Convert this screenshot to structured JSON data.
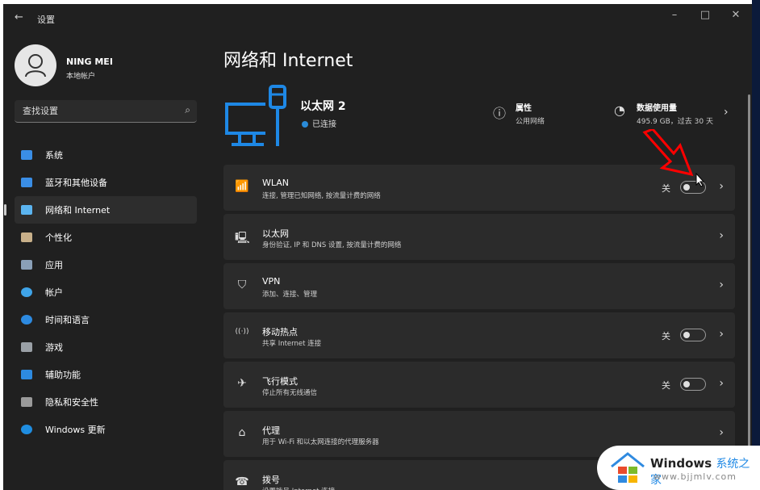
{
  "window": {
    "title": "设置",
    "controls": {
      "minimize": "–",
      "maximize": "□",
      "close": "✕"
    }
  },
  "user": {
    "name": "NING MEI",
    "type": "本地帐户"
  },
  "search": {
    "placeholder": "查找设置"
  },
  "sidebar": {
    "items": [
      {
        "label": "系统",
        "icon": "system-icon",
        "color": "#3a8ee6",
        "selected": false
      },
      {
        "label": "蓝牙和其他设备",
        "icon": "bluetooth-icon",
        "color": "#3a8ee6",
        "selected": false
      },
      {
        "label": "网络和 Internet",
        "icon": "network-icon",
        "color": "#5bb4f0",
        "selected": true
      },
      {
        "label": "个性化",
        "icon": "brush-icon",
        "color": "#c8b08a",
        "selected": false
      },
      {
        "label": "应用",
        "icon": "apps-icon",
        "color": "#8aa0b8",
        "selected": false
      },
      {
        "label": "帐户",
        "icon": "account-icon",
        "color": "#3fa4e8",
        "selected": false
      },
      {
        "label": "时间和语言",
        "icon": "time-language-icon",
        "color": "#2d8ae0",
        "selected": false
      },
      {
        "label": "游戏",
        "icon": "gaming-icon",
        "color": "#9aa0a6",
        "selected": false
      },
      {
        "label": "辅助功能",
        "icon": "accessibility-icon",
        "color": "#2d8ae0",
        "selected": false
      },
      {
        "label": "隐私和安全性",
        "icon": "shield-icon",
        "color": "#9a9a9a",
        "selected": false
      },
      {
        "label": "Windows 更新",
        "icon": "update-icon",
        "color": "#1f8de0",
        "selected": false
      }
    ]
  },
  "main": {
    "title": "网络和 Internet",
    "hero": {
      "network_name": "以太网 2",
      "status": "已连接",
      "properties": {
        "title": "属性",
        "subtitle": "公用网络"
      },
      "data_usage": {
        "title": "数据使用量",
        "subtitle": "495.9 GB，过去 30 天"
      }
    },
    "cards": [
      {
        "title": "WLAN",
        "subtitle": "连接, 管理已知网络, 按流量计费的网络",
        "icon": "wifi-icon",
        "toggle": "关",
        "toggle_on": false
      },
      {
        "title": "以太网",
        "subtitle": "身份验证, IP 和 DNS 设置, 按流量计费的网络",
        "icon": "ethernet-icon"
      },
      {
        "title": "VPN",
        "subtitle": "添加、连接、管理",
        "icon": "vpn-shield-icon"
      },
      {
        "title": "移动热点",
        "subtitle": "共享 Internet 连接",
        "icon": "hotspot-icon",
        "toggle": "关",
        "toggle_on": false
      },
      {
        "title": "飞行模式",
        "subtitle": "停止所有无线通信",
        "icon": "airplane-icon",
        "toggle": "关",
        "toggle_on": false
      },
      {
        "title": "代理",
        "subtitle": "用于 Wi-Fi 和以太网连接的代理服务器",
        "icon": "proxy-icon"
      },
      {
        "title": "拨号",
        "subtitle": "设置拨号 Internet 连接",
        "icon": "dialup-icon"
      }
    ]
  },
  "watermark": {
    "brand": "Windows",
    "brand_cn": "系统之家",
    "url": "www.bjjmlv.com"
  },
  "colors": {
    "accent": "#2b8ad9",
    "background": "#202020",
    "card": "#2b2b2b",
    "annotation_arrow": "#ff0000"
  }
}
